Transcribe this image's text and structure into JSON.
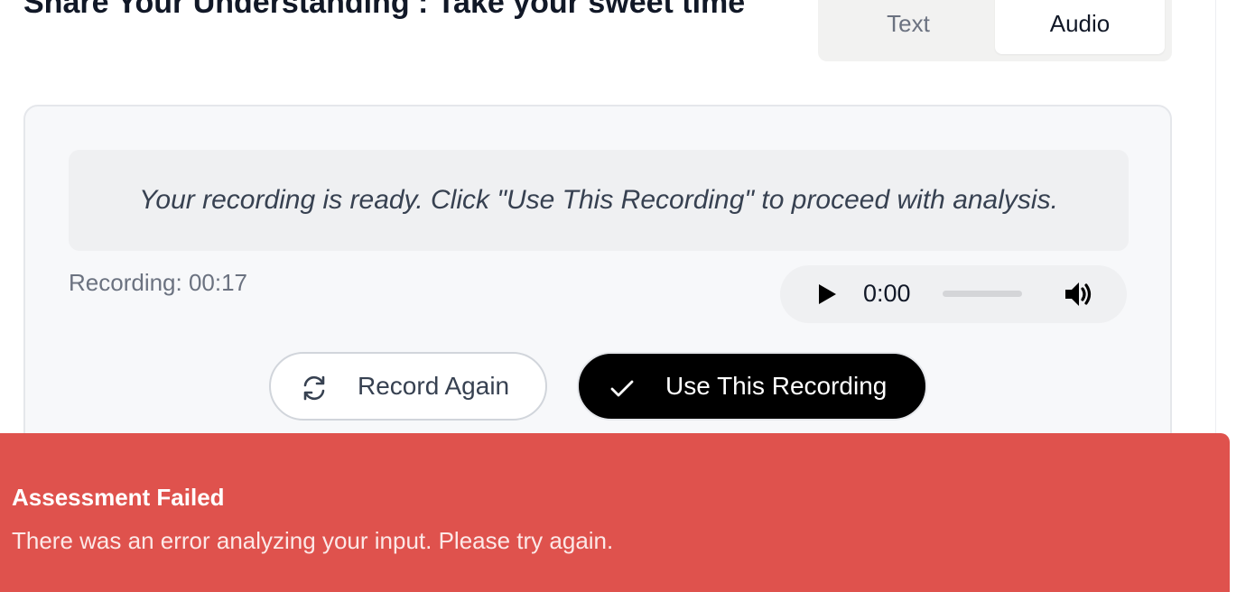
{
  "header": {
    "title": "Share Your Understanding : Take your sweet time"
  },
  "mode_toggle": {
    "tabs": [
      "Text",
      "Audio"
    ],
    "selected": "Audio"
  },
  "recording": {
    "ready_message": "Your recording is ready. Click \"Use This Recording\" to proceed with analysis.",
    "duration_label": "Recording: 00:17",
    "player": {
      "current_time": "0:00",
      "progress": 0
    },
    "record_again_label": "Record Again",
    "use_recording_label": "Use This Recording"
  },
  "toast": {
    "title": "Assessment Failed",
    "description": "There was an error analyzing your input. Please try again.",
    "color": "#df524d"
  },
  "icons": {
    "refresh": "refresh-icon",
    "check": "check-icon",
    "play": "play-icon",
    "volume": "volume-icon"
  }
}
